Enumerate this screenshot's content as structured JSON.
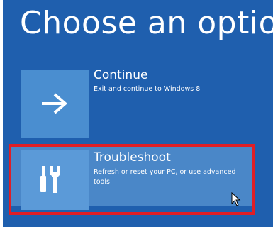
{
  "page": {
    "title": "Choose an option"
  },
  "options": {
    "continue": {
      "label": "Continue",
      "description": "Exit and continue to Windows 8",
      "icon": "arrow-right-icon"
    },
    "troubleshoot": {
      "label": "Troubleshoot",
      "description": "Refresh or reset your PC, or use advanced tools",
      "icon": "tools-icon",
      "selected": true
    }
  },
  "colors": {
    "background": "#1f5fae",
    "tile": "#4a8ed0",
    "highlight": "#4a87c8",
    "annotation_outline": "#e01e26",
    "text": "#ffffff"
  }
}
